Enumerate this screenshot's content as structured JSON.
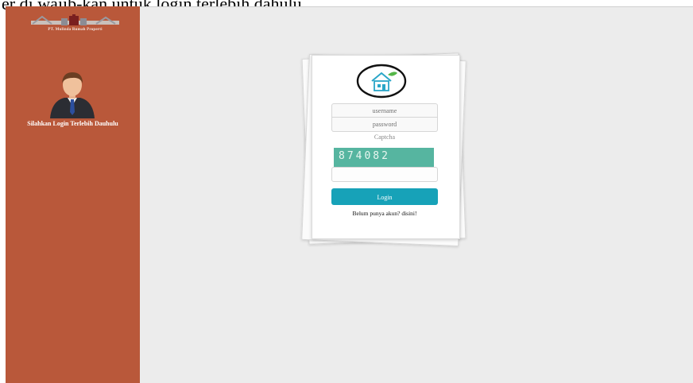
{
  "banner": {
    "text": "er di wajib-kan untuk login terlebih dahulu."
  },
  "sidebar": {
    "logo_text": "PT. Mulinda Rumah Properti",
    "message": "Silahkan Login Terlebih Dauhulu"
  },
  "login": {
    "username_placeholder": "username",
    "password_placeholder": "password",
    "captcha_label": "Captcha",
    "captcha_code": "874082",
    "submit_label": "Login",
    "register_text": "Belum punya akun? disini!"
  },
  "colors": {
    "sidebar": "#b9583a",
    "button": "#17a2b8",
    "captcha": "#56b5a0"
  }
}
